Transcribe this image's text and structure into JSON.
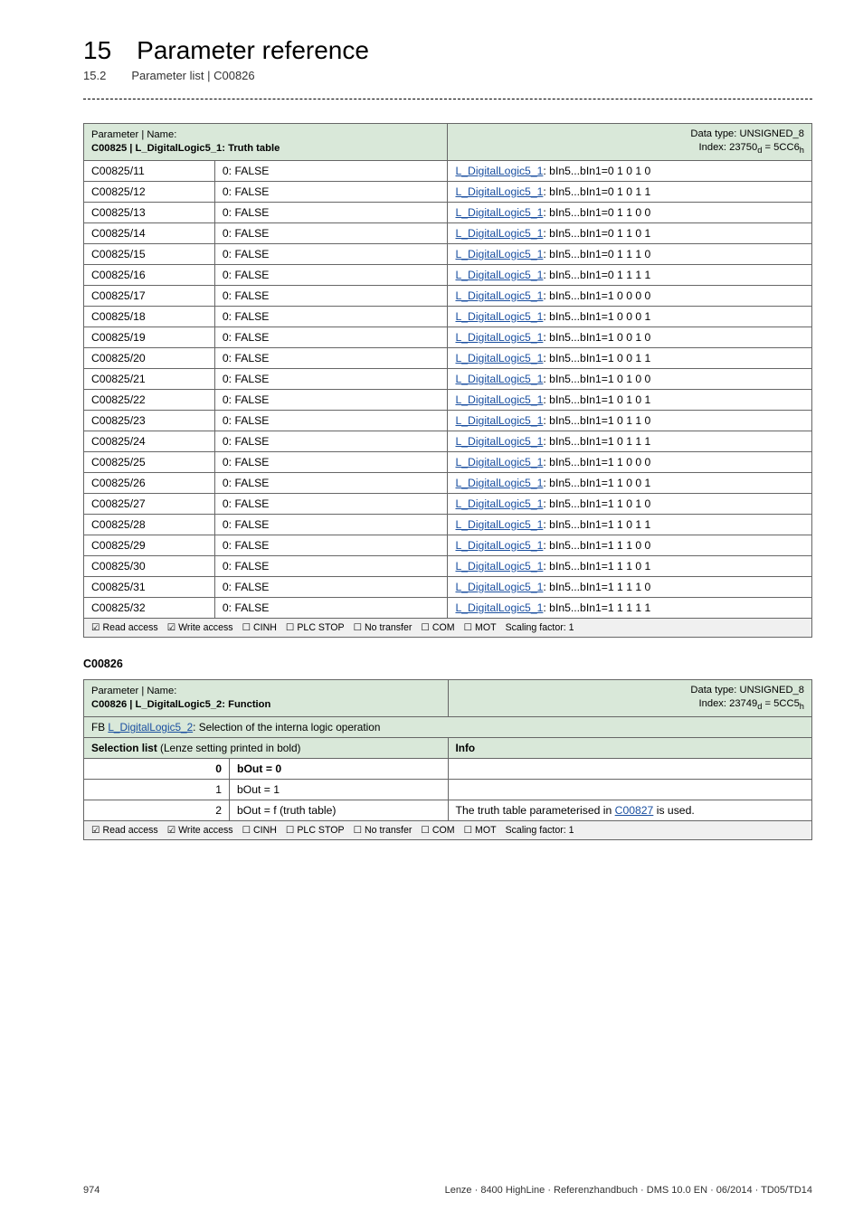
{
  "header": {
    "chapter_num": "15",
    "chapter_title": "Parameter reference",
    "section_num": "15.2",
    "section_title": "Parameter list | C00826"
  },
  "table1": {
    "header": {
      "left_label": "Parameter | Name:",
      "name": "C00825 | L_DigitalLogic5_1: Truth table",
      "right_l1": "Data type: UNSIGNED_8",
      "right_l2": "Index: 23750",
      "right_l2_sub1": "d",
      "right_l2_mid": " = 5CC6",
      "right_l2_sub2": "h"
    },
    "rows": [
      {
        "p": "C00825/11",
        "v": "0: FALSE",
        "link": "L_DigitalLogic5_1",
        "tail": ": bIn5...bIn1=0 1 0 1 0"
      },
      {
        "p": "C00825/12",
        "v": "0: FALSE",
        "link": "L_DigitalLogic5_1",
        "tail": ": bIn5...bIn1=0 1 0 1 1"
      },
      {
        "p": "C00825/13",
        "v": "0: FALSE",
        "link": "L_DigitalLogic5_1",
        "tail": ": bIn5...bIn1=0 1 1 0 0"
      },
      {
        "p": "C00825/14",
        "v": "0: FALSE",
        "link": "L_DigitalLogic5_1",
        "tail": ": bIn5...bIn1=0 1 1 0 1"
      },
      {
        "p": "C00825/15",
        "v": "0: FALSE",
        "link": "L_DigitalLogic5_1",
        "tail": ": bIn5...bIn1=0 1 1 1 0"
      },
      {
        "p": "C00825/16",
        "v": "0: FALSE",
        "link": "L_DigitalLogic5_1",
        "tail": ": bIn5...bIn1=0 1 1 1 1"
      },
      {
        "p": "C00825/17",
        "v": "0: FALSE",
        "link": "L_DigitalLogic5_1",
        "tail": ": bIn5...bIn1=1 0 0 0 0"
      },
      {
        "p": "C00825/18",
        "v": "0: FALSE",
        "link": "L_DigitalLogic5_1",
        "tail": ": bIn5...bIn1=1 0 0 0 1"
      },
      {
        "p": "C00825/19",
        "v": "0: FALSE",
        "link": "L_DigitalLogic5_1",
        "tail": ": bIn5...bIn1=1 0 0 1 0"
      },
      {
        "p": "C00825/20",
        "v": "0: FALSE",
        "link": "L_DigitalLogic5_1",
        "tail": ": bIn5...bIn1=1 0 0 1 1"
      },
      {
        "p": "C00825/21",
        "v": "0: FALSE",
        "link": "L_DigitalLogic5_1",
        "tail": ": bIn5...bIn1=1 0 1 0 0"
      },
      {
        "p": "C00825/22",
        "v": "0: FALSE",
        "link": "L_DigitalLogic5_1",
        "tail": ": bIn5...bIn1=1 0 1 0 1"
      },
      {
        "p": "C00825/23",
        "v": "0: FALSE",
        "link": "L_DigitalLogic5_1",
        "tail": ": bIn5...bIn1=1 0 1 1 0"
      },
      {
        "p": "C00825/24",
        "v": "0: FALSE",
        "link": "L_DigitalLogic5_1",
        "tail": ": bIn5...bIn1=1 0 1 1 1"
      },
      {
        "p": "C00825/25",
        "v": "0: FALSE",
        "link": "L_DigitalLogic5_1",
        "tail": ": bIn5...bIn1=1 1 0 0 0"
      },
      {
        "p": "C00825/26",
        "v": "0: FALSE",
        "link": "L_DigitalLogic5_1",
        "tail": ": bIn5...bIn1=1 1 0 0 1"
      },
      {
        "p": "C00825/27",
        "v": "0: FALSE",
        "link": "L_DigitalLogic5_1",
        "tail": ": bIn5...bIn1=1 1 0 1 0"
      },
      {
        "p": "C00825/28",
        "v": "0: FALSE",
        "link": "L_DigitalLogic5_1",
        "tail": ": bIn5...bIn1=1 1 0 1 1"
      },
      {
        "p": "C00825/29",
        "v": "0: FALSE",
        "link": "L_DigitalLogic5_1",
        "tail": ": bIn5...bIn1=1 1 1 0 0"
      },
      {
        "p": "C00825/30",
        "v": "0: FALSE",
        "link": "L_DigitalLogic5_1",
        "tail": ": bIn5...bIn1=1 1 1 0 1"
      },
      {
        "p": "C00825/31",
        "v": "0: FALSE",
        "link": "L_DigitalLogic5_1",
        "tail": ": bIn5...bIn1=1 1 1 1 0"
      },
      {
        "p": "C00825/32",
        "v": "0: FALSE",
        "link": "L_DigitalLogic5_1",
        "tail": ": bIn5...bIn1=1 1 1 1 1"
      }
    ],
    "footer_items": [
      "☑ Read access",
      "☑ Write access",
      "☐ CINH",
      "☐ PLC STOP",
      "☐ No transfer",
      "☐ COM",
      "☐ MOT",
      "Scaling factor: 1"
    ]
  },
  "section2_label": "C00826",
  "table2": {
    "header": {
      "left_label": "Parameter | Name:",
      "name": "C00826 | L_DigitalLogic5_2: Function",
      "right_l1": "Data type: UNSIGNED_8",
      "right_l2": "Index: 23749",
      "right_l2_sub1": "d",
      "right_l2_mid": " = 5CC5",
      "right_l2_sub2": "h"
    },
    "fb_prefix": "FB ",
    "fb_link": "L_DigitalLogic5_2",
    "fb_tail": ": Selection of the interna logic operation",
    "sel_label": "Selection list",
    "sel_hint": " (Lenze setting printed in bold)",
    "info_label": "Info",
    "rows": [
      {
        "n": "0",
        "v": "bOut = 0",
        "bold": true,
        "info": ""
      },
      {
        "n": "1",
        "v": "bOut = 1",
        "bold": false,
        "info": ""
      },
      {
        "n": "2",
        "v": "bOut = f (truth table)",
        "bold": false,
        "info_pre": "The truth table parameterised in ",
        "info_link": "C00827",
        "info_post": "  is used."
      }
    ],
    "footer_items": [
      "☑ Read access",
      "☑ Write access",
      "☐ CINH",
      "☐ PLC STOP",
      "☐ No transfer",
      "☐ COM",
      "☐ MOT",
      "Scaling factor: 1"
    ]
  },
  "footer": {
    "page": "974",
    "right": "Lenze · 8400 HighLine · Referenzhandbuch · DMS 10.0 EN · 06/2014 · TD05/TD14"
  }
}
